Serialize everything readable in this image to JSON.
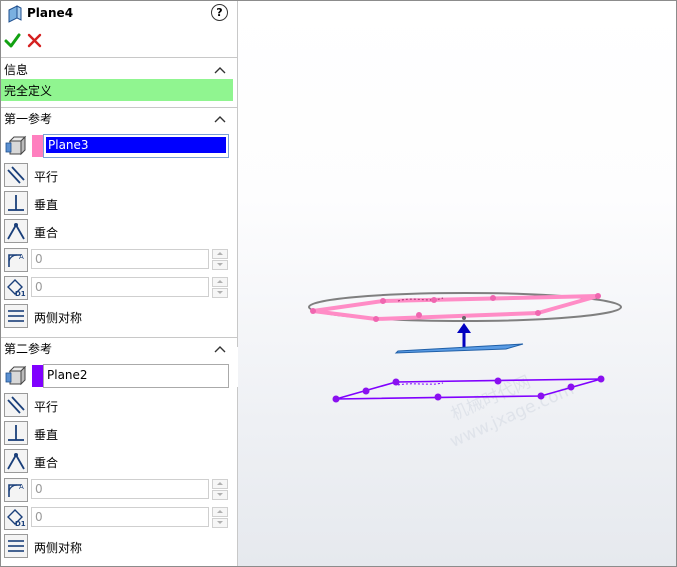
{
  "title": "Plane4",
  "help_glyph": "?",
  "info_section": {
    "label": "信息",
    "status": "完全定义",
    "status_color": "#90f590"
  },
  "first_reference": {
    "label": "第一参考",
    "value": "Plane3",
    "swatch_color": "#ff7fbf",
    "options": {
      "parallel": "平行",
      "perpendicular": "垂直",
      "coincident": "重合",
      "both_sides": "两侧对称"
    },
    "angle_value": "0",
    "offset_value": "0"
  },
  "second_reference": {
    "label": "第二参考",
    "value": "Plane2",
    "swatch_color": "#8000ff",
    "options": {
      "parallel": "平行",
      "perpendicular": "垂直",
      "coincident": "重合",
      "both_sides": "两侧对称"
    },
    "angle_value": "0",
    "offset_value": "0"
  },
  "viewport": {
    "watermark_line1": "机械时代网",
    "watermark_line2": "www.jxage.com",
    "colors": {
      "first_plane": "#ff7fbf",
      "second_plane": "#8000ff",
      "preview_plane": "#3d8be0",
      "normal_arrow": "#0000c0"
    }
  }
}
